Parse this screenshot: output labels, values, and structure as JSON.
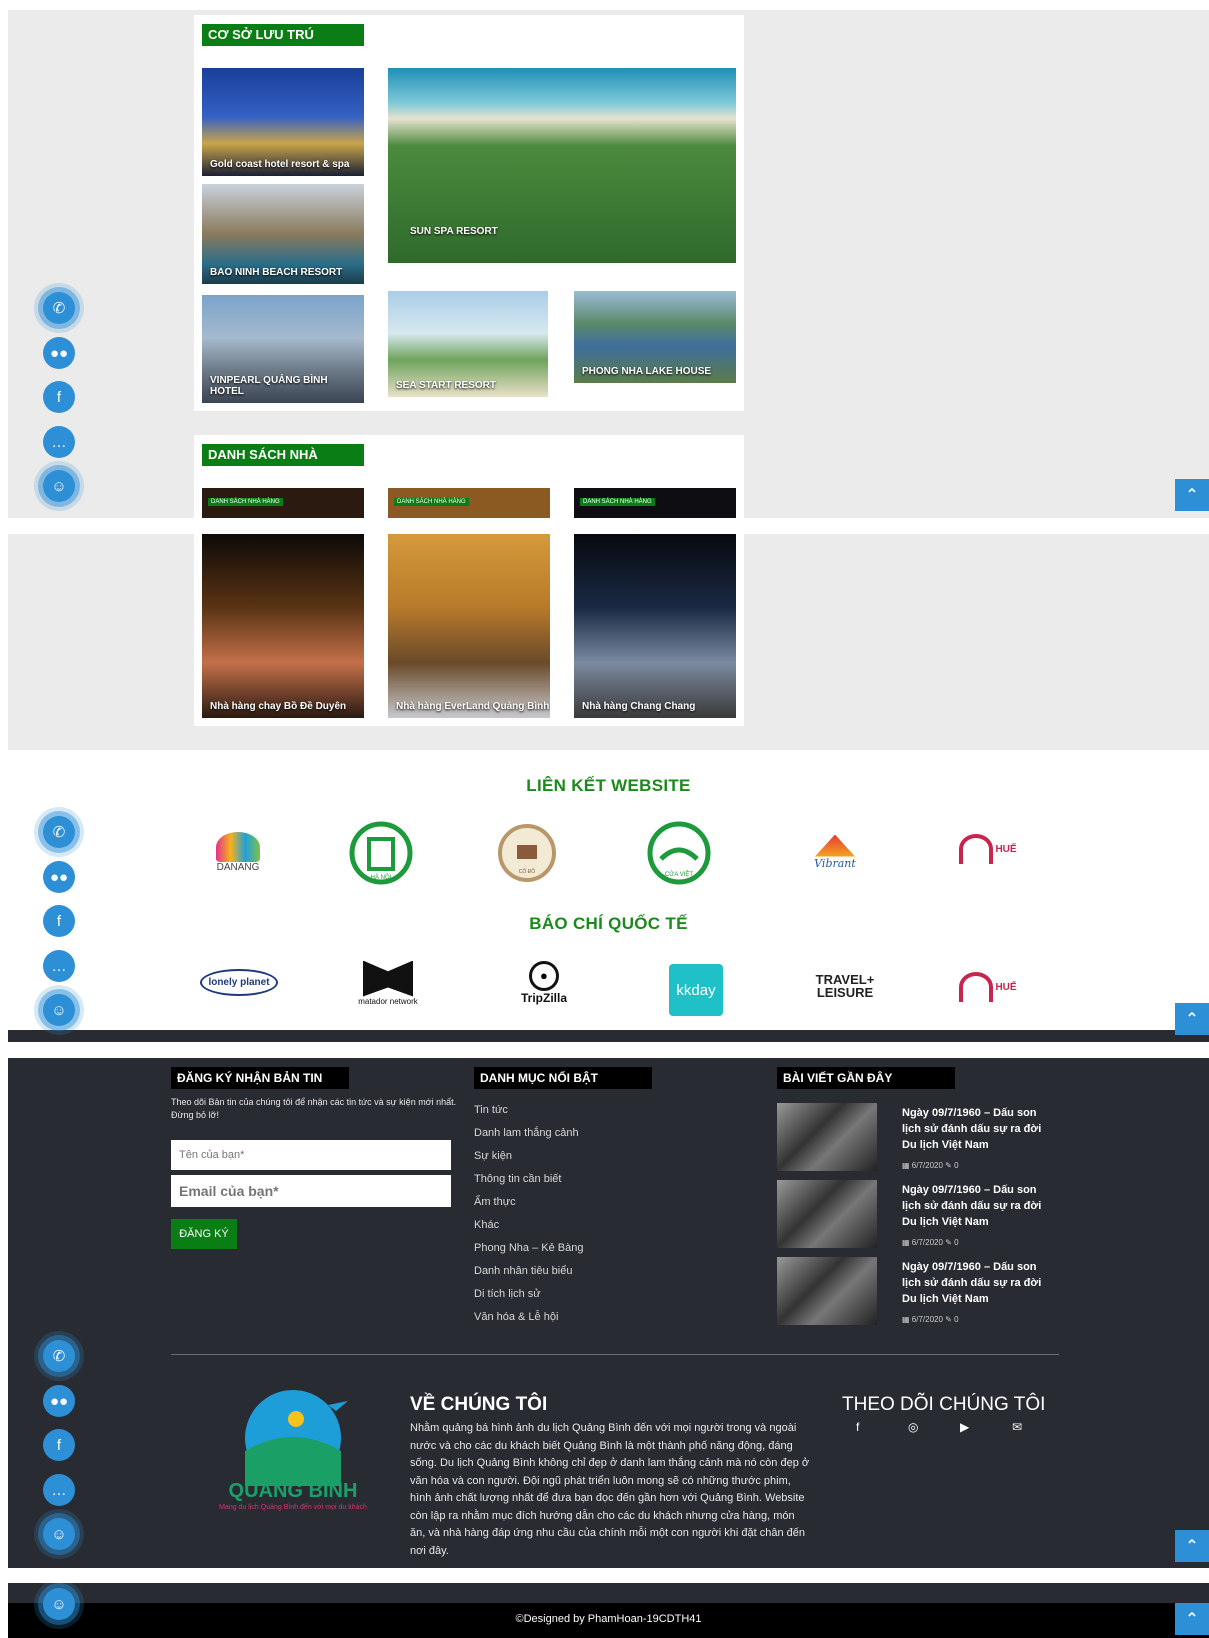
{
  "lodging": {
    "title": "CƠ SỞ LƯU TRÚ",
    "items": [
      "Gold coast hotel resort & spa",
      "BAO NINH BEACH RESORT",
      "SUN SPA RESORT",
      "VINPEARL QUẢNG BÌNH HOTEL",
      "SEA START RESORT",
      "PHONG NHA LAKE HOUSE"
    ]
  },
  "restaurants": {
    "title": "DANH SÁCH NHÀ HÀNG",
    "tag": "DANH SÁCH NHÀ HÀNG",
    "items": [
      "Nhà hàng chay Bồ Đề Duyên",
      "Nhà hàng EverLand Quảng Bình",
      "Nhà hàng Chang Chang"
    ]
  },
  "links": {
    "title": "LIÊN KẾT WEBSITE",
    "logos": [
      "DANANG",
      "HÀ NỘI",
      "CỐ ĐÔ",
      "CỬA VIỆT",
      "Vibrant",
      "HUẾ"
    ]
  },
  "press": {
    "title": "BÁO CHÍ QUỐC TẾ",
    "logos": [
      "lonely planet",
      "matador network",
      "TripZilla",
      "kkday",
      "TRAVEL+ LEISURE",
      "HUẾ"
    ]
  },
  "newsletter": {
    "title": "ĐĂNG KÝ NHẬN BẢN TIN",
    "desc": "Theo dõi Bản tin của chúng tôi để nhận các tin tức và sự kiện mới nhất. Đừng bỏ lỡ!",
    "name_placeholder": "Tên của bạn*",
    "email_placeholder": "Email của bạn*",
    "button": "ĐĂNG KÝ"
  },
  "categories": {
    "title": "DANH MỤC NỔI BẬT",
    "items": [
      "Tin tức",
      "Danh lam thắng cảnh",
      "Sự kiện",
      "Thông tin cần biết",
      "Ẩm thực",
      "Khác",
      "Phong Nha – Kẻ Bàng",
      "Danh nhân tiêu biểu",
      "Di tích lịch sử",
      "Văn hóa & Lễ hội"
    ]
  },
  "recent": {
    "title": "BÀI VIẾT GẦN ĐÂY",
    "posts": [
      {
        "title": "Ngày 09/7/1960 – Dấu son lịch sử đánh dấu sự ra đời Du lịch Việt Nam",
        "date": "6/7/2020",
        "comments": "0"
      },
      {
        "title": "Ngày 09/7/1960 – Dấu son lịch sử đánh dấu sự ra đời Du lịch Việt Nam",
        "date": "6/7/2020",
        "comments": "0"
      },
      {
        "title": "Ngày 09/7/1960 – Dấu son lịch sử đánh dấu sự ra đời Du lịch Việt Nam",
        "date": "6/7/2020",
        "comments": "0"
      }
    ]
  },
  "brand": {
    "name": "QUẢNG BÌNH",
    "slogan": "Mang du lịch Quảng Bình đến với mọi du khách"
  },
  "about": {
    "title": "VỀ CHÚNG TÔI",
    "text": "Nhằm quảng bá hình ảnh du lịch Quảng Bình đến với mọi người trong và ngoài nước và cho các du khách biết Quảng Bình là một thành phố năng động, đáng sống. Du lịch Quảng Bình không chỉ đẹp ở danh lam thắng cảnh mà nó còn đẹp ở văn hóa và con người. Đội ngũ phát triển luôn mong sẽ có những thước phim, hình ảnh chất lượng nhất để đưa bạn đọc đến gần hơn với Quảng Bình. Website còn lập ra nhằm mục đích hướng dẫn cho các du khách nhưng cửa hàng, món ăn, và nhà hàng đáp ứng nhu cầu của chính mỗi một con người khi đặt chân đến nơi đây."
  },
  "follow": {
    "title": "THEO DÕI CHÚNG TÔI",
    "icons": [
      "facebook-icon",
      "instagram-icon",
      "youtube-icon",
      "mail-icon"
    ]
  },
  "copyright": "©Designed by PhamHoan-19CDTH41",
  "colors": {
    "green": "#0a7d15",
    "blue": "#2d8fd6",
    "footer": "#282b31"
  }
}
